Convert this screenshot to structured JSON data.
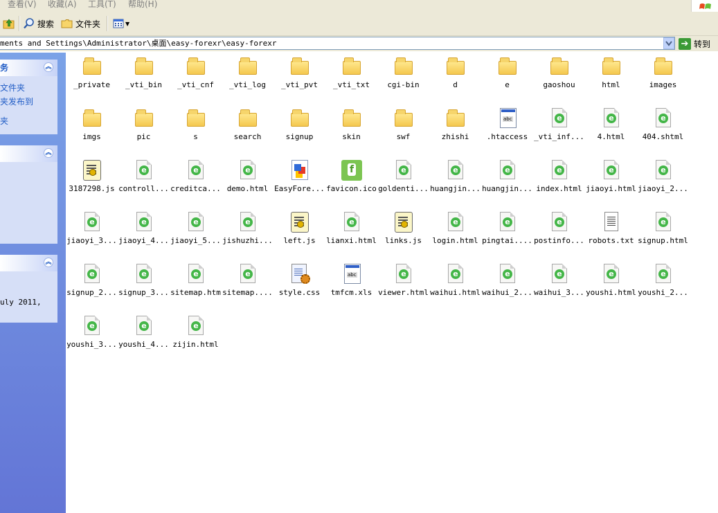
{
  "menu": {
    "view": "查看(V)",
    "favorites": "收藏(A)",
    "tools": "工具(T)",
    "help": "帮助(H)"
  },
  "toolbar": {
    "search_label": "搜索",
    "folders_label": "文件夹"
  },
  "address": {
    "path": "ments and Settings\\Administrator\\桌面\\easy-forexr\\easy-forexr",
    "go_label": "转到"
  },
  "taskpane": {
    "panel1_title": "务",
    "panel1_links": [
      "文件夹",
      "夹发布到",
      "夹"
    ],
    "panel4_text": "uly 2011,"
  },
  "files": [
    {
      "name": "_private",
      "type": "folder"
    },
    {
      "name": "_vti_bin",
      "type": "folder"
    },
    {
      "name": "_vti_cnf",
      "type": "folder"
    },
    {
      "name": "_vti_log",
      "type": "folder"
    },
    {
      "name": "_vti_pvt",
      "type": "folder"
    },
    {
      "name": "_vti_txt",
      "type": "folder"
    },
    {
      "name": "cgi-bin",
      "type": "folder"
    },
    {
      "name": "d",
      "type": "folder"
    },
    {
      "name": "e",
      "type": "folder"
    },
    {
      "name": "gaoshou",
      "type": "folder"
    },
    {
      "name": "html",
      "type": "folder"
    },
    {
      "name": "images",
      "type": "folder"
    },
    {
      "name": "imgs",
      "type": "folder"
    },
    {
      "name": "pic",
      "type": "folder"
    },
    {
      "name": "s",
      "type": "folder"
    },
    {
      "name": "search",
      "type": "folder"
    },
    {
      "name": "signup",
      "type": "folder"
    },
    {
      "name": "skin",
      "type": "folder"
    },
    {
      "name": "swf",
      "type": "folder"
    },
    {
      "name": "zhishi",
      "type": "folder"
    },
    {
      "name": ".htaccess",
      "type": "windoc"
    },
    {
      "name": "_vti_inf...",
      "type": "html"
    },
    {
      "name": "4.html",
      "type": "html"
    },
    {
      "name": "404.shtml",
      "type": "html"
    },
    {
      "name": "3187298.js",
      "type": "script"
    },
    {
      "name": "controll...",
      "type": "html"
    },
    {
      "name": "creditca...",
      "type": "html"
    },
    {
      "name": "demo.html",
      "type": "html"
    },
    {
      "name": "EasyFore...",
      "type": "app"
    },
    {
      "name": "favicon.ico",
      "type": "favicon"
    },
    {
      "name": "goldenti...",
      "type": "html"
    },
    {
      "name": "huangjin...",
      "type": "html"
    },
    {
      "name": "huangjin...",
      "type": "html"
    },
    {
      "name": "index.html",
      "type": "html"
    },
    {
      "name": "jiaoyi.html",
      "type": "html"
    },
    {
      "name": "jiaoyi_2...",
      "type": "html"
    },
    {
      "name": "jiaoyi_3...",
      "type": "html"
    },
    {
      "name": "jiaoyi_4...",
      "type": "html"
    },
    {
      "name": "jiaoyi_5...",
      "type": "html"
    },
    {
      "name": "jishuzhi...",
      "type": "html"
    },
    {
      "name": "left.js",
      "type": "script"
    },
    {
      "name": "lianxi.html",
      "type": "html"
    },
    {
      "name": "links.js",
      "type": "script"
    },
    {
      "name": "login.html",
      "type": "html"
    },
    {
      "name": "pingtai....",
      "type": "html"
    },
    {
      "name": "postinfo...",
      "type": "html"
    },
    {
      "name": "robots.txt",
      "type": "txt"
    },
    {
      "name": "signup.html",
      "type": "html"
    },
    {
      "name": "signup_2...",
      "type": "html"
    },
    {
      "name": "signup_3...",
      "type": "html"
    },
    {
      "name": "sitemap.htm",
      "type": "html"
    },
    {
      "name": "sitemap....",
      "type": "html"
    },
    {
      "name": "style.css",
      "type": "css"
    },
    {
      "name": "tmfcm.xls",
      "type": "windoc"
    },
    {
      "name": "viewer.html",
      "type": "html"
    },
    {
      "name": "waihui.html",
      "type": "html"
    },
    {
      "name": "waihui_2...",
      "type": "html"
    },
    {
      "name": "waihui_3...",
      "type": "html"
    },
    {
      "name": "youshi.html",
      "type": "html"
    },
    {
      "name": "youshi_2...",
      "type": "html"
    },
    {
      "name": "youshi_3...",
      "type": "html"
    },
    {
      "name": "youshi_4...",
      "type": "html"
    },
    {
      "name": "zijin.html",
      "type": "html"
    }
  ]
}
